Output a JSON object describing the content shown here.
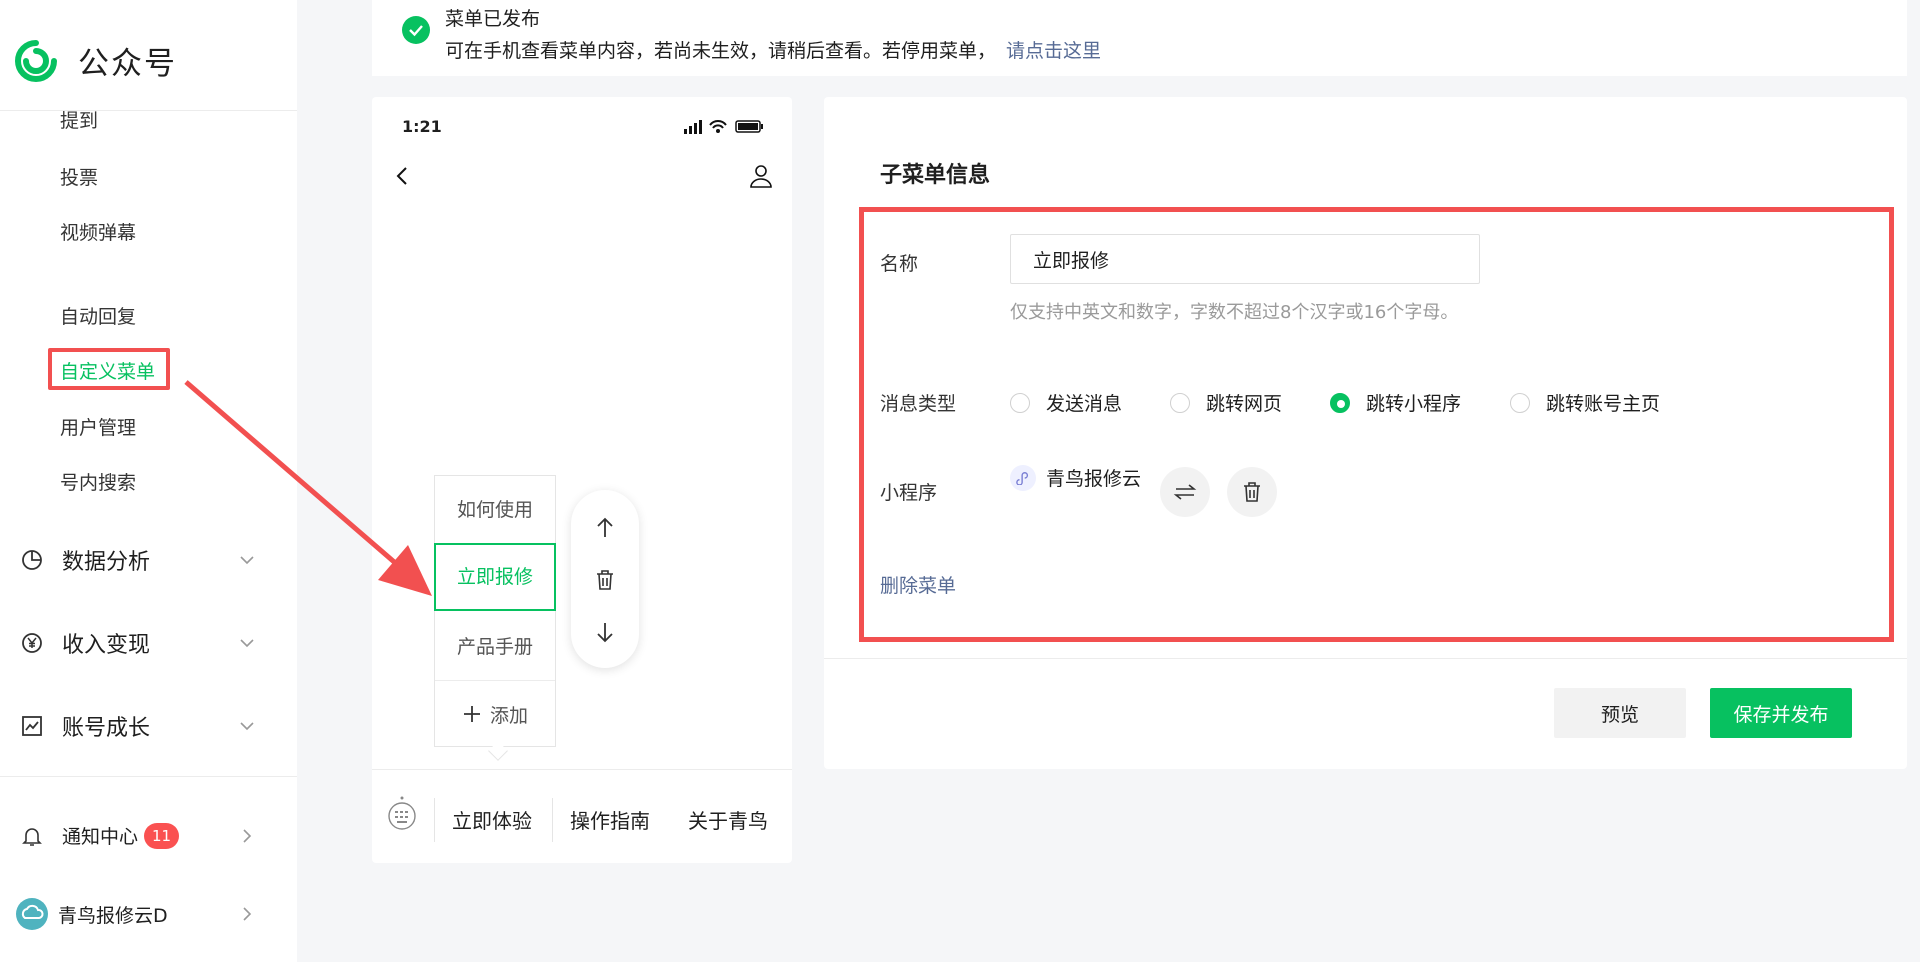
{
  "brand": {
    "name": "公众号"
  },
  "sidebar": {
    "sub_items": [
      {
        "label": "提到"
      },
      {
        "label": "投票"
      },
      {
        "label": "视频弹幕"
      },
      {
        "label": "自动回复"
      },
      {
        "label": "自定义菜单"
      },
      {
        "label": "用户管理"
      },
      {
        "label": "号内搜索"
      }
    ],
    "groups": [
      {
        "label": "数据分析",
        "icon": "pie-chart-icon"
      },
      {
        "label": "收入变现",
        "icon": "yen-icon"
      },
      {
        "label": "账号成长",
        "icon": "trend-chart-icon"
      }
    ],
    "notifications": {
      "label": "通知中心",
      "count": "11"
    },
    "account": {
      "label": "青鸟报修云D"
    }
  },
  "notice": {
    "title": "菜单已发布",
    "message": "可在手机查看菜单内容，若尚未生效，请稍后查看。若停用菜单，",
    "link": "请点击这里"
  },
  "phone": {
    "time": "1:21",
    "submenu": [
      {
        "label": "如何使用"
      },
      {
        "label": "立即报修"
      },
      {
        "label": "产品手册"
      }
    ],
    "add_label": "添加",
    "menu_tabs": [
      {
        "label": "立即体验"
      },
      {
        "label": "操作指南"
      },
      {
        "label": "关于青鸟"
      }
    ]
  },
  "panel": {
    "title": "子菜单信息",
    "name_label": "名称",
    "name_value": "立即报修",
    "hint": "仅支持中英文和数字，字数不超过8个汉字或16个字母。",
    "type_label": "消息类型",
    "types": [
      {
        "label": "发送消息",
        "checked": false
      },
      {
        "label": "跳转网页",
        "checked": false
      },
      {
        "label": "跳转小程序",
        "checked": true
      },
      {
        "label": "跳转账号主页",
        "checked": false
      }
    ],
    "miniprogram_label": "小程序",
    "miniprogram_name": "青鸟报修云",
    "delete_link": "删除菜单",
    "preview_button": "预览",
    "save_button": "保存并发布"
  },
  "colors": {
    "accent": "#07c160",
    "highlight": "#f25050",
    "link": "#576b95"
  }
}
